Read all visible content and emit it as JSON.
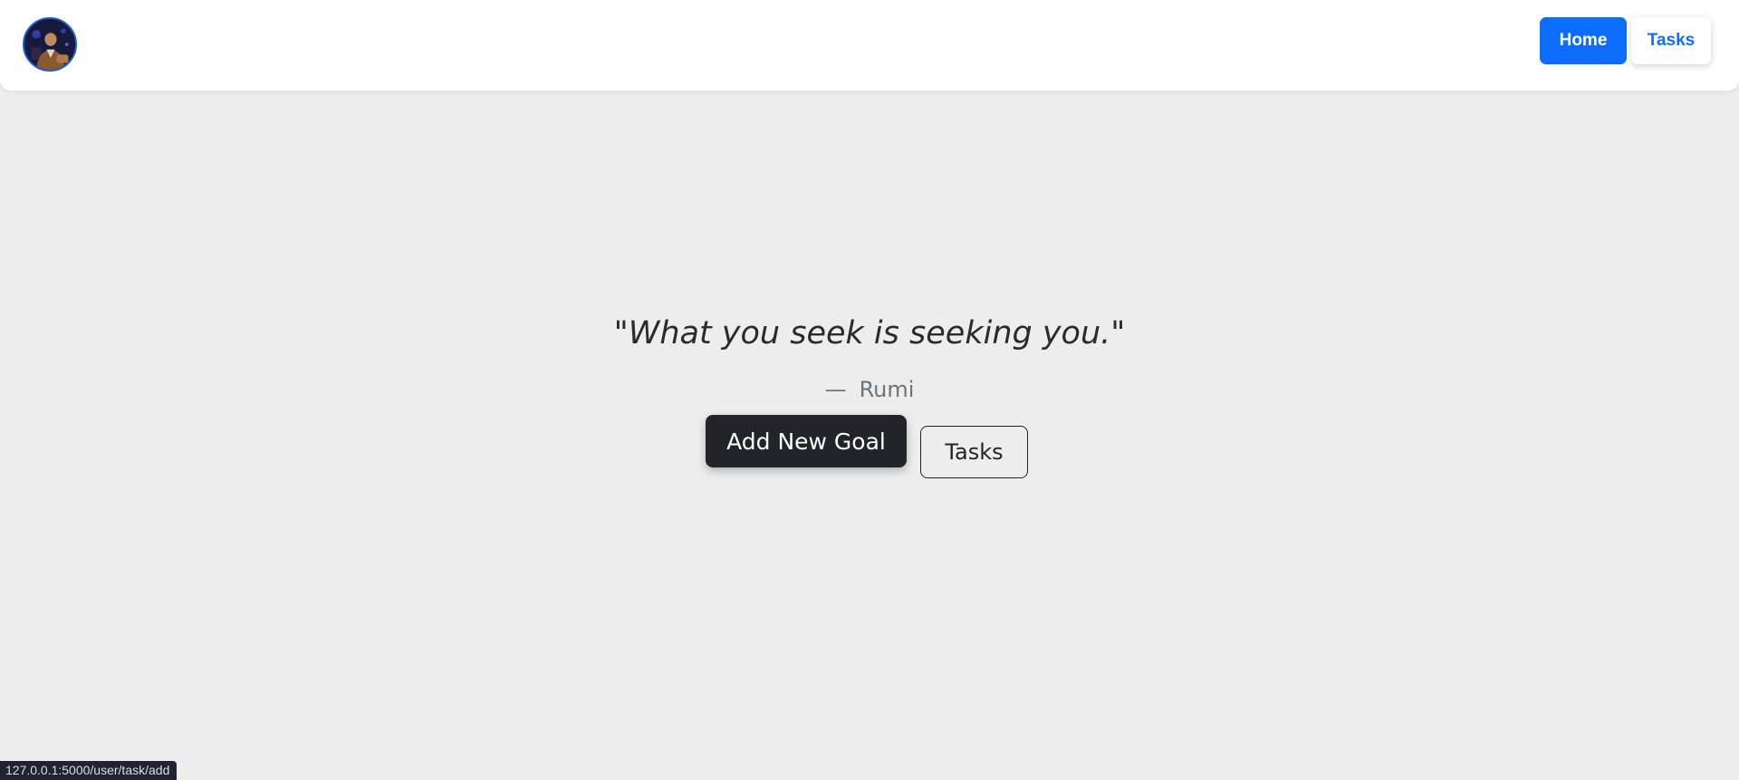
{
  "nav": {
    "avatar_alt": "profile avatar",
    "home_label": "Home",
    "tasks_label": "Tasks"
  },
  "hero": {
    "quote_open": "\"",
    "quote_text": "What you seek is seeking you.",
    "quote_close": "\"",
    "author_dash": "—",
    "author": "Rumi",
    "primary_button_label": "Add New Goal",
    "secondary_button_label": "Tasks"
  },
  "status_bar": {
    "url": "127.0.0.1:5000/user/task/add"
  },
  "colors": {
    "background": "#ededed",
    "navbar": "#ffffff",
    "primary": "#0d6efd",
    "dark_button": "#212529",
    "muted_text": "#6c757d"
  },
  "icons": {
    "avatar": "user-avatar-photo"
  }
}
